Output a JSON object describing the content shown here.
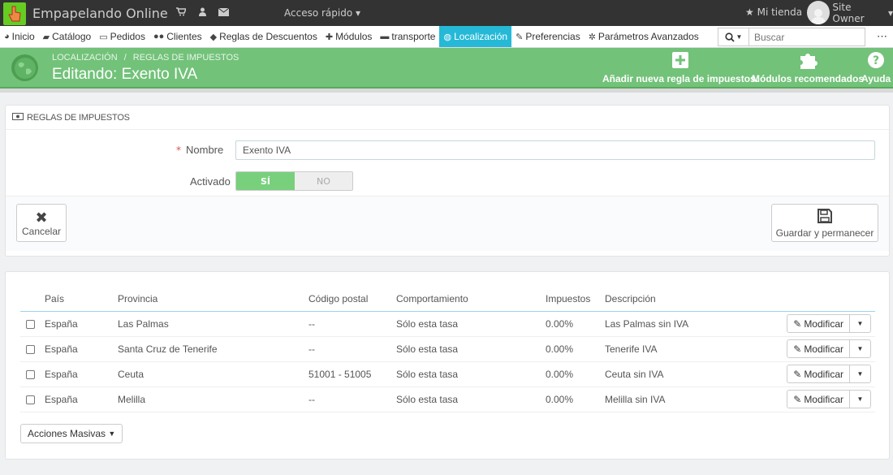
{
  "topbar": {
    "shop_name": "Empapelando Online",
    "quick_access": "Acceso rápido",
    "my_store": "Mi tienda",
    "owner": "Site Owner"
  },
  "nav": {
    "items": [
      {
        "label": "Inicio",
        "icon": "dashboard-icon"
      },
      {
        "label": "Catálogo",
        "icon": "book-icon"
      },
      {
        "label": "Pedidos",
        "icon": "credit-card-icon"
      },
      {
        "label": "Clientes",
        "icon": "users-icon"
      },
      {
        "label": "Reglas de Descuentos",
        "icon": "tags-icon"
      },
      {
        "label": "Módulos",
        "icon": "puzzle-icon"
      },
      {
        "label": "transporte",
        "icon": "truck-icon"
      },
      {
        "label": "Localización",
        "icon": "globe-icon"
      },
      {
        "label": "Preferencias",
        "icon": "wrench-icon"
      },
      {
        "label": "Parámetros Avanzados",
        "icon": "cogs-icon"
      }
    ],
    "active": "Localización",
    "search_placeholder": "Buscar"
  },
  "header": {
    "breadcrumb": [
      "Localización",
      "Reglas de impuestos"
    ],
    "title": "Editando: Exento IVA",
    "actions": {
      "add_rule": "Añadir nueva regla de impuestos.",
      "modules": "Módulos recomendados",
      "help": "Ayuda"
    }
  },
  "form": {
    "panel_title": "REGLAS DE IMPUESTOS",
    "name_label": "Nombre",
    "name_value": "Exento IVA",
    "active_label": "Activado",
    "yes": "SÍ",
    "no": "NO",
    "active_value": "SÍ",
    "cancel": "Cancelar",
    "save": "Guardar y permanecer"
  },
  "table": {
    "headers": [
      "País",
      "Provincia",
      "Código postal",
      "Comportamiento",
      "Impuestos",
      "Descripción"
    ],
    "rows": [
      {
        "country": "España",
        "state": "Las Palmas",
        "zip": "--",
        "behavior": "Sólo esta tasa",
        "tax": "0.00%",
        "description": "Las Palmas sin IVA"
      },
      {
        "country": "España",
        "state": "Santa Cruz de Tenerife",
        "zip": "--",
        "behavior": "Sólo esta tasa",
        "tax": "0.00%",
        "description": "Tenerife IVA"
      },
      {
        "country": "España",
        "state": "Ceuta",
        "zip": "51001 - 51005",
        "behavior": "Sólo esta tasa",
        "tax": "0.00%",
        "description": "Ceuta sin IVA"
      },
      {
        "country": "España",
        "state": "Melilla",
        "zip": "--",
        "behavior": "Sólo esta tasa",
        "tax": "0.00%",
        "description": "Melilla sin IVA"
      }
    ],
    "modify_label": "Modificar",
    "bulk_actions": "Acciones Masivas"
  },
  "colors": {
    "active_nav": "#25b9d7",
    "header_green": "#72c279",
    "switch_yes": "#78d07d"
  }
}
